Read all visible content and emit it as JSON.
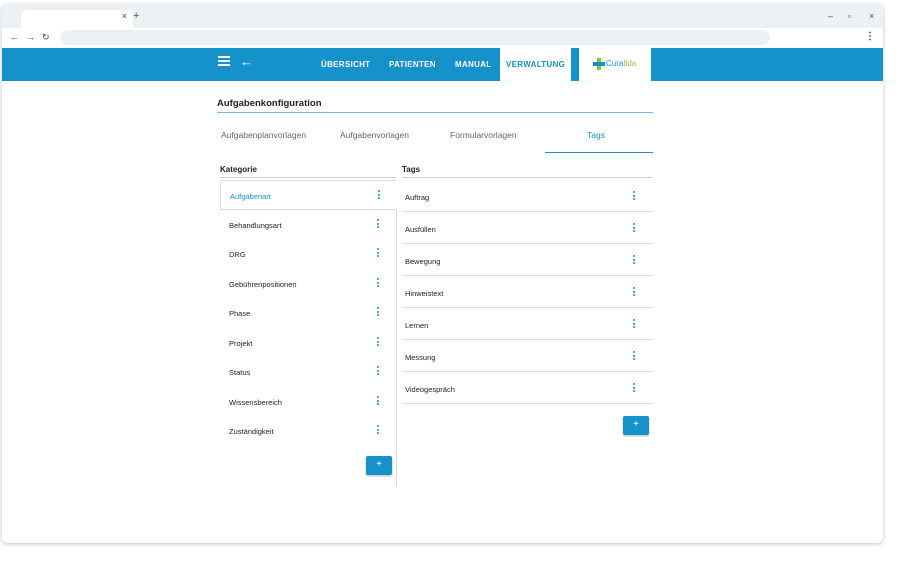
{
  "browser": {
    "tab_close": "×",
    "new_tab": "+",
    "minimize": "–",
    "restore": "▫",
    "close": "×",
    "back": "←",
    "forward": "→",
    "reload": "↻",
    "menu": "⋮"
  },
  "appbar": {
    "back_arrow": "←",
    "nav": [
      "ÜBERSICHT",
      "PATIENTEN",
      "MANUAL",
      "VERWALTUNG"
    ],
    "active_nav": "VERWALTUNG",
    "logo_main": "Cura",
    "logo_accent": "fida",
    "brand_color": "#1592c9",
    "logo_accent_color": "#8cc63f"
  },
  "page": {
    "title": "Aufgabenkonfiguration",
    "tabs": [
      "Aufgabenplanvorlagen",
      "Aufgabenvorlagen",
      "Formularvorlagen",
      "Tags"
    ],
    "active_tab": "Tags"
  },
  "categories": {
    "header": "Kategorie",
    "items": [
      "Aufgabenart",
      "Behandlungsart",
      "DRG",
      "Gebührenpositionen",
      "Phase",
      "Projekt",
      "Status",
      "Wissensbereich",
      "Zuständigkeit"
    ],
    "selected": "Aufgabenart",
    "add_label": "+"
  },
  "tags": {
    "header": "Tags",
    "items": [
      "Auftrag",
      "Ausfüllen",
      "Bewegung",
      "Hinweistext",
      "Lernen",
      "Messung",
      "Videogespräch"
    ],
    "add_label": "+"
  },
  "icons": {
    "hamburger": "hamburger-icon",
    "row_menu": "more-vert-icon",
    "logo": "curafida-cross-icon"
  }
}
